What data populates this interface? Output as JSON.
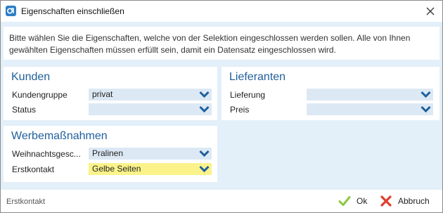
{
  "window": {
    "title": "Eigenschaften einschließen"
  },
  "intro": {
    "text": "Bitte wählen Sie die Eigenschaften, welche von der Selektion eingeschlossen werden sollen. Alle von Ihnen gewählten Eigenschaften müssen erfüllt sein, damit ein Datensatz eingeschlossen wird."
  },
  "kunden": {
    "title": "Kunden",
    "fields": [
      {
        "label": "Kundengruppe",
        "value": "privat"
      },
      {
        "label": "Status",
        "value": ""
      }
    ]
  },
  "lieferanten": {
    "title": "Lieferanten",
    "fields": [
      {
        "label": "Lieferung",
        "value": ""
      },
      {
        "label": "Preis",
        "value": ""
      }
    ]
  },
  "werbemassnahmen": {
    "title": "Werbemaßnahmen",
    "fields": [
      {
        "label": "Weihnachtsgesc...",
        "value": "Pralinen"
      },
      {
        "label": "Erstkontakt",
        "value": "Gelbe Seiten"
      }
    ]
  },
  "footer": {
    "status": "Erstkontakt",
    "ok_label": "Ok",
    "cancel_label": "Abbruch"
  },
  "colors": {
    "accent": "#1f5f9b",
    "combo_bg": "#dce9f5",
    "highlight": "#fbf38a",
    "ok_green": "#8dc63f",
    "cancel_red": "#e23b2e"
  },
  "icons": {
    "app": "app-logo-icon",
    "close": "close-icon",
    "dropdown": "chevron-down-icon",
    "ok": "checkmark-icon",
    "cancel": "x-icon"
  }
}
